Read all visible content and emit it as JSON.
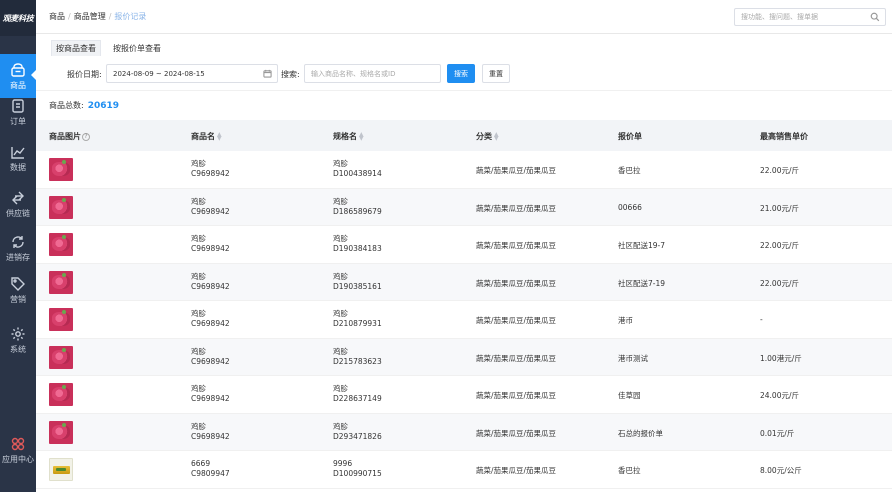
{
  "brand": {
    "logo_text": "观麦科技",
    "accent": "#1f8ef1",
    "sidebar_bg": "#2a3447"
  },
  "sidebar": {
    "items": [
      {
        "label": "商品",
        "icon": "shop-bag-icon",
        "active": true
      },
      {
        "label": "订单",
        "icon": "document-icon"
      },
      {
        "label": "数据",
        "icon": "line-chart-icon"
      },
      {
        "label": "供应链",
        "icon": "exchange-arrows-icon"
      },
      {
        "label": "进销存",
        "icon": "refresh-cycle-icon"
      },
      {
        "label": "营销",
        "icon": "tag-icon"
      },
      {
        "label": "系统",
        "icon": "gear-icon"
      }
    ],
    "bottom": {
      "label": "应用中心",
      "icon": "app-center-icon"
    }
  },
  "header": {
    "breadcrumb": [
      "商品",
      "商品管理",
      "报价记录"
    ],
    "search_placeholder": "搜功能、搜问题、搜单据"
  },
  "tabs": [
    {
      "label": "按商品查看",
      "active": true
    },
    {
      "label": "按报价单查看",
      "active": false
    }
  ],
  "filters": {
    "date_label": "报价日期:",
    "date_range": "2024-08-09 ~ 2024-08-15",
    "search_label": "搜索:",
    "search_placeholder": "输入商品名称、规格名或ID",
    "search_button": "搜索",
    "reset_button": "重置"
  },
  "summary": {
    "label": "商品总数:",
    "count": "20619"
  },
  "table": {
    "columns": [
      "商品图片",
      "商品名",
      "规格名",
      "分类",
      "报价单",
      "最高销售单价"
    ],
    "rows": [
      {
        "name": "鸡胗",
        "code": "C9698942",
        "spec": "鸡胗",
        "spec_id": "D100438914",
        "category": "蔬菜/茄果瓜豆/茄果瓜豆",
        "quote": "香巴拉",
        "price": "22.00元/斤"
      },
      {
        "name": "鸡胗",
        "code": "C9698942",
        "spec": "鸡胗",
        "spec_id": "D186589679",
        "category": "蔬菜/茄果瓜豆/茄果瓜豆",
        "quote": "00666",
        "price": "21.00元/斤"
      },
      {
        "name": "鸡胗",
        "code": "C9698942",
        "spec": "鸡胗",
        "spec_id": "D190384183",
        "category": "蔬菜/茄果瓜豆/茄果瓜豆",
        "quote": "社区配送19-7",
        "price": "22.00元/斤"
      },
      {
        "name": "鸡胗",
        "code": "C9698942",
        "spec": "鸡胗",
        "spec_id": "D190385161",
        "category": "蔬菜/茄果瓜豆/茄果瓜豆",
        "quote": "社区配送7-19",
        "price": "22.00元/斤"
      },
      {
        "name": "鸡胗",
        "code": "C9698942",
        "spec": "鸡胗",
        "spec_id": "D210879931",
        "category": "蔬菜/茄果瓜豆/茄果瓜豆",
        "quote": "港币",
        "price": "-"
      },
      {
        "name": "鸡胗",
        "code": "C9698942",
        "spec": "鸡胗",
        "spec_id": "D215783623",
        "category": "蔬菜/茄果瓜豆/茄果瓜豆",
        "quote": "港币测试",
        "price": "1.00港元/斤"
      },
      {
        "name": "鸡胗",
        "code": "C9698942",
        "spec": "鸡胗",
        "spec_id": "D228637149",
        "category": "蔬菜/茄果瓜豆/茄果瓜豆",
        "quote": "佳草园",
        "price": "24.00元/斤"
      },
      {
        "name": "鸡胗",
        "code": "C9698942",
        "spec": "鸡胗",
        "spec_id": "D293471826",
        "category": "蔬菜/茄果瓜豆/茄果瓜豆",
        "quote": "石总的报价单",
        "price": "0.01元/斤"
      },
      {
        "name": "6669",
        "code": "C9809947",
        "spec": "9996",
        "spec_id": "D100990715",
        "category": "蔬菜/茄果瓜豆/茄果瓜豆",
        "quote": "香巴拉",
        "price": "8.00元/公斤"
      }
    ]
  }
}
